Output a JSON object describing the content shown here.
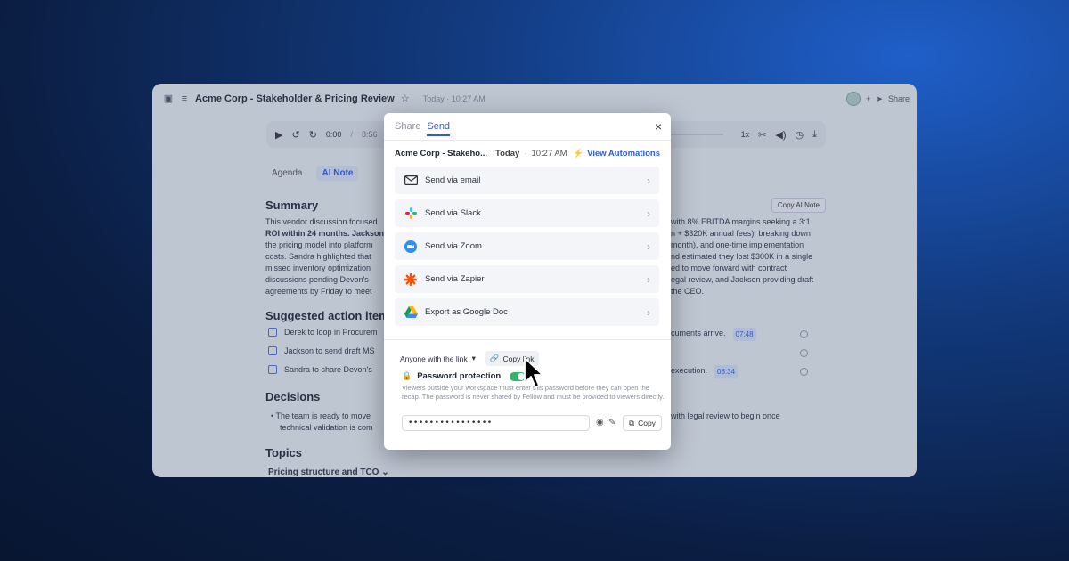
{
  "app": {
    "title": "Acme Corp - Stakeholder & Pricing Review",
    "date": "Today · 10:27 AM",
    "share_label": "Share",
    "player": {
      "time": "0:00",
      "duration": "8:56",
      "speed": "1x"
    },
    "tabs": [
      {
        "label": "Agenda"
      },
      {
        "label": "AI Note"
      }
    ],
    "copy_note_label": "Copy AI Note",
    "summary": {
      "heading": "Summary",
      "lines_left": [
        "This vendor discussion focused",
        "ROI within 24 months. Jackson",
        "the pricing model into platform",
        "costs. Sandra highlighted that",
        "missed inventory optimization",
        "discussions pending Devon's",
        "agreements by Friday to meet"
      ],
      "lines_right": [
        "with 8% EBITDA margins seeking a 3:1",
        "n + $320K annual fees), breaking down",
        "month), and one-time implementation",
        "nd estimated they lost $300K in a single",
        "ed to move forward with contract",
        "egal review, and Jackson providing draft",
        "the CEO."
      ]
    },
    "actions": {
      "heading": "Suggested action items",
      "items": [
        {
          "left": "Derek to loop in Procurem",
          "right": "cuments arrive.",
          "ts": "07:48"
        },
        {
          "left": "Jackson to send draft MS",
          "right": "",
          "ts": ""
        },
        {
          "left": "Sandra to share Devon's",
          "right": "execution.",
          "ts": "08:34"
        }
      ]
    },
    "decisions": {
      "heading": "Decisions",
      "line1_left": "The team is ready to move",
      "line1_right": "with legal review to begin once",
      "line2": "technical validation is com"
    },
    "topics": {
      "heading": "Topics",
      "first": "Pricing structure and TCO"
    }
  },
  "modal": {
    "tabs": [
      {
        "label": "Share"
      },
      {
        "label": "Send"
      }
    ],
    "close_glyph": "×",
    "meeting_title": "Acme Corp - Stakeho...",
    "meeting_date": "Today",
    "meeting_time": "10:27 AM",
    "automations_label": "View Automations",
    "send_options": [
      {
        "label": "Send via email",
        "icon": "mail-icon"
      },
      {
        "label": "Send via Slack",
        "icon": "slack-icon"
      },
      {
        "label": "Send via Zoom",
        "icon": "zoom-icon"
      },
      {
        "label": "Send via Zapier",
        "icon": "zapier-icon"
      },
      {
        "label": "Export as Google Doc",
        "icon": "google-drive-icon"
      }
    ],
    "access_label": "Anyone with the link",
    "copy_link_label": "Copy link",
    "password_label": "Password protection",
    "password_desc": "Viewers outside your workspace must enter this password before they can open the recap. The password is never shared by Fellow and must be provided to viewers directly.",
    "password_value": "••••••••••••••••",
    "copy_label": "Copy"
  },
  "colors": {
    "accent": "#2e5bd8",
    "toggle_on": "#34b36a"
  }
}
